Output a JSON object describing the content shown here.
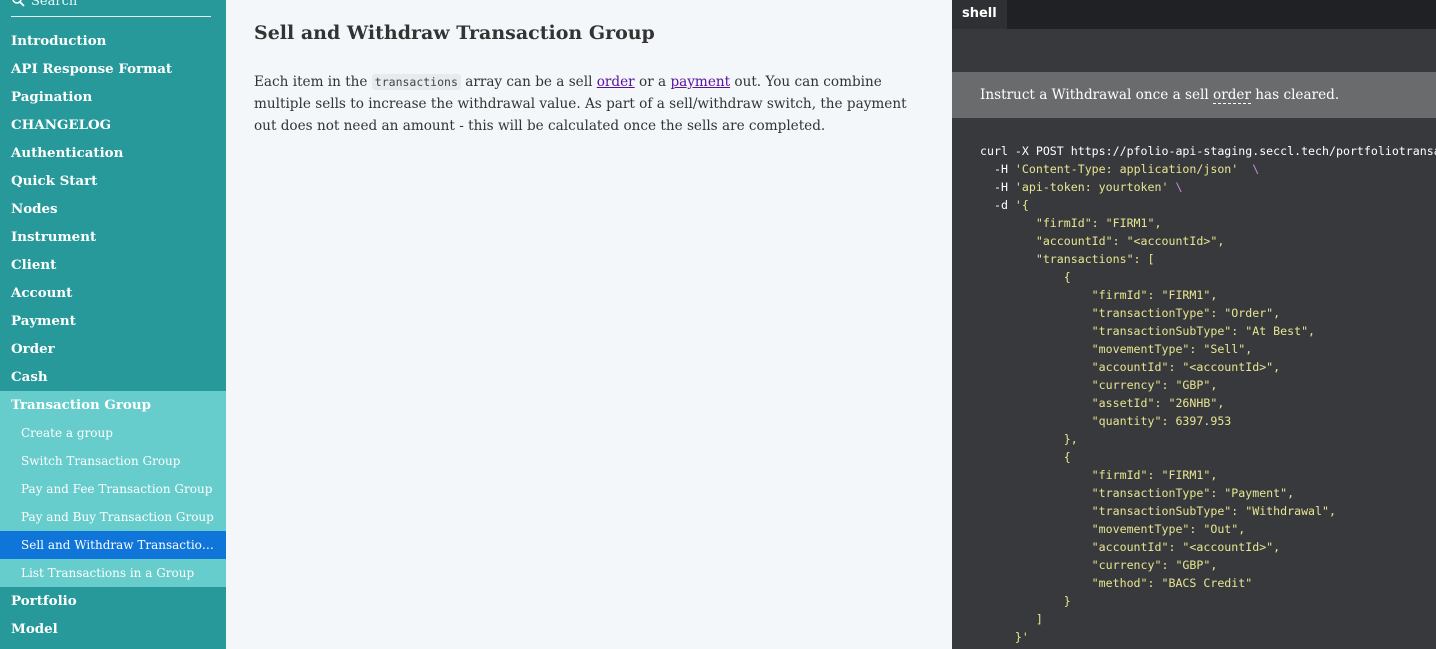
{
  "sidebar": {
    "search_placeholder": "Search",
    "items_top": [
      {
        "label": "Introduction"
      },
      {
        "label": "API Response Format"
      },
      {
        "label": "Pagination"
      },
      {
        "label": "CHANGELOG"
      },
      {
        "label": "Authentication"
      },
      {
        "label": "Quick Start"
      },
      {
        "label": "Nodes"
      },
      {
        "label": "Instrument"
      },
      {
        "label": "Client"
      },
      {
        "label": "Account"
      },
      {
        "label": "Payment"
      },
      {
        "label": "Order"
      },
      {
        "label": "Cash"
      }
    ],
    "active_item": {
      "label": "Transaction Group"
    },
    "sub_items": [
      {
        "label": "Create a group"
      },
      {
        "label": "Switch Transaction Group"
      },
      {
        "label": "Pay and Fee Transaction Group"
      },
      {
        "label": "Pay and Buy Transaction Group"
      },
      {
        "label": "Sell and Withdraw Transaction ..."
      },
      {
        "label": "List Transactions in a Group"
      }
    ],
    "selected_sub_index": 4,
    "items_bottom": [
      {
        "label": "Portfolio"
      },
      {
        "label": "Model"
      }
    ]
  },
  "main": {
    "title": "Sell and Withdraw Transaction Group",
    "intro": {
      "t1": "Each item in the ",
      "code": "transactions",
      "t2": " array can be a sell ",
      "link1": "order",
      "t3": " or a ",
      "link2": "payment",
      "t4": " out. You can combine multiple sells to increase the withdrawal value. As part of a sell/withdraw switch, the payment out does not need an amount - this will be calculated once the sells are completed."
    }
  },
  "code_panel": {
    "tab_label": "shell",
    "description": {
      "t1": "Instruct a Withdrawal once a sell ",
      "term": "order",
      "t2": " has cleared."
    },
    "lines": [
      {
        "plain": "curl -X POST https://pfolio-api-staging.seccl.tech/portfoliotransactiongroup"
      },
      {
        "plain": "  -H ",
        "str": "'Content-Type: application/json'",
        "esc": "  \\"
      },
      {
        "plain": "  -H ",
        "str": "'api-token: yourtoken'",
        "esc": " \\"
      },
      {
        "plain": "  -d ",
        "str": "'{"
      },
      {
        "str": "        \"firmId\": \"FIRM1\","
      },
      {
        "str": "        \"accountId\": \"<accountId>\","
      },
      {
        "str": "        \"transactions\": ["
      },
      {
        "str": "            {"
      },
      {
        "str": "                \"firmId\": \"FIRM1\","
      },
      {
        "str": "                \"transactionType\": \"Order\","
      },
      {
        "str": "                \"transactionSubType\": \"At Best\","
      },
      {
        "str": "                \"movementType\": \"Sell\","
      },
      {
        "str": "                \"accountId\": \"<accountId>\","
      },
      {
        "str": "                \"currency\": \"GBP\","
      },
      {
        "str": "                \"assetId\": \"26NHB\","
      },
      {
        "str": "                \"quantity\": 6397.953"
      },
      {
        "str": "            },"
      },
      {
        "str": "            {"
      },
      {
        "str": "                \"firmId\": \"FIRM1\","
      },
      {
        "str": "                \"transactionType\": \"Payment\","
      },
      {
        "str": "                \"transactionSubType\": \"Withdrawal\","
      },
      {
        "str": "                \"movementType\": \"Out\","
      },
      {
        "str": "                \"accountId\": \"<accountId>\","
      },
      {
        "str": "                \"currency\": \"GBP\","
      },
      {
        "str": "                \"method\": \"BACS Credit\""
      },
      {
        "str": "            }"
      },
      {
        "str": "        ]"
      },
      {
        "str": "     }'"
      }
    ]
  },
  "colors": {
    "sidebar_bg": "#27999a",
    "sidebar_active_bg": "#66cccc",
    "sidebar_selected_bg": "#0f75d9",
    "link": "#5b0f9c",
    "code_bg": "#38393d",
    "code_string": "#e7e58f"
  }
}
